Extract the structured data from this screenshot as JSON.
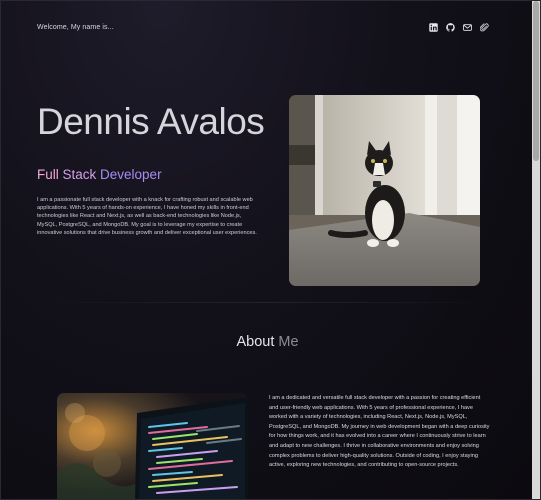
{
  "header": {
    "greeting": "Welcome, My name is...",
    "socials": [
      {
        "icon": "linkedin-icon"
      },
      {
        "icon": "github-icon"
      },
      {
        "icon": "mail-icon"
      },
      {
        "icon": "paperclip-icon"
      }
    ]
  },
  "hero": {
    "name": "Dennis Avalos",
    "role": {
      "part1": "Full ",
      "part2": "Stack ",
      "part3": "Developer"
    },
    "bio": "I am a passionate full stack developer with a knack for crafting robust and scalable web applications. With 5 years of hands-on experience, I have honed my skills in front-end technologies like React and Next.js, as well as back-end technologies like Node.js, MySQL, PostgreSQL, and MongoDB. My goal is to leverage my expertise to create innovative solutions that drive business growth and deliver exceptional user experiences.",
    "photo_icon": "cat-photo"
  },
  "about": {
    "title_part1": "About ",
    "title_part2": "Me",
    "text": "I am a dedicated and versatile full stack developer with a passion for creating efficient and user-friendly web applications. With 5 years of professional experience, I have worked with a variety of technologies, including React, Next.js, Node.js, MySQL, PostgreSQL, and MongoDB. My journey in web development began with a deep curiosity for how things work, and it has evolved into a career where I continuously strive to learn and adapt to new challenges. I thrive in collaborative environments and enjoy solving complex problems to deliver high-quality solutions. Outside of coding, I enjoy staying active, exploring new technologies, and contributing to open-source projects.",
    "photo_icon": "code-screen-photo"
  },
  "colors": {
    "role_full": "#f1a6dc",
    "role_stack": "#d3a0e8",
    "role_dev": "#a98cf2",
    "background": "#0b0a0f"
  }
}
